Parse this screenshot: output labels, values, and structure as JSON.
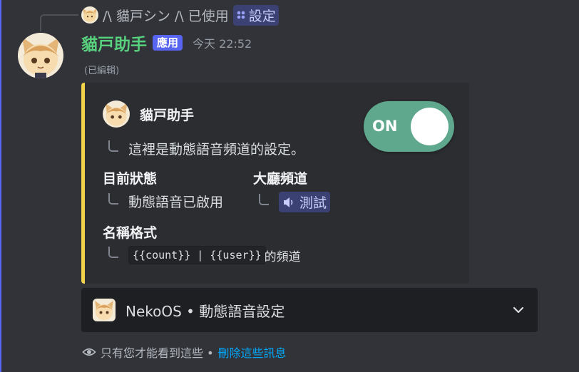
{
  "reply": {
    "user_name": "/\\ 貓戸シン /\\",
    "used_text": "已使用",
    "command_label": "設定"
  },
  "message": {
    "author": "貓戸助手",
    "badge": "應用",
    "timestamp": "今天 22:52",
    "edited": "(已編輯)"
  },
  "embed": {
    "accent_color": "#f0d24b",
    "author_name": "貓戸助手",
    "description": "這裡是動態語音頻道的設定。",
    "toggle_label": "ON",
    "toggle_color": "#5fa78d",
    "fields": [
      {
        "name": "目前狀態",
        "value": "動態語音已啟用"
      },
      {
        "name": "大廳頻道",
        "value": "測試",
        "icon": "speaker-icon"
      },
      {
        "name": "名稱格式",
        "value": "{{count}} | {{user}}",
        "suffix": " 的頻道"
      }
    ]
  },
  "select_menu": {
    "value": "NekoOS • 動態語音設定",
    "icon": "chevron-down-icon"
  },
  "ephemeral": {
    "notice": "只有您才能看到這些 •",
    "dismiss_link": "刪除這些訊息",
    "icon": "eye-icon"
  }
}
